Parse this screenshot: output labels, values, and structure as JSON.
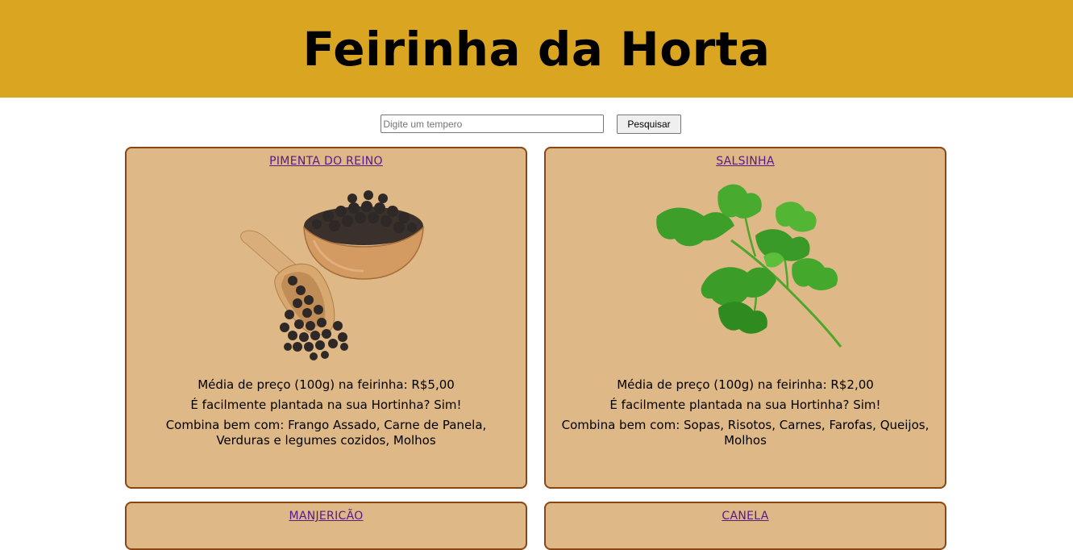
{
  "header": {
    "title": "Feirinha da Horta"
  },
  "search": {
    "placeholder": "Digite um tempero",
    "value": "",
    "button_label": "Pesquisar"
  },
  "cards": [
    {
      "name": "PIMENTA DO REINO",
      "image_icon": "black-pepper-bowl-image",
      "price": "Média de preço (100g) na feirinha: R$5,00",
      "easy_plant": "É facilmente plantada na sua Hortinha? Sim!",
      "pairs": "Combina bem com: Frango Assado, Carne de Panela, Verduras e legumes cozidos, Molhos"
    },
    {
      "name": "SALSINHA",
      "image_icon": "parsley-sprig-image",
      "price": "Média de preço (100g) na feirinha: R$2,00",
      "easy_plant": "É facilmente plantada na sua Hortinha? Sim!",
      "pairs": "Combina bem com: Sopas, Risotos, Carnes, Farofas, Queijos, Molhos"
    },
    {
      "name": "MANJERICÃO"
    },
    {
      "name": "CANELA"
    }
  ],
  "colors": {
    "header_bg": "#daa520",
    "card_bg": "#deb887",
    "card_border": "#8b4513",
    "link": "#551a8b"
  }
}
